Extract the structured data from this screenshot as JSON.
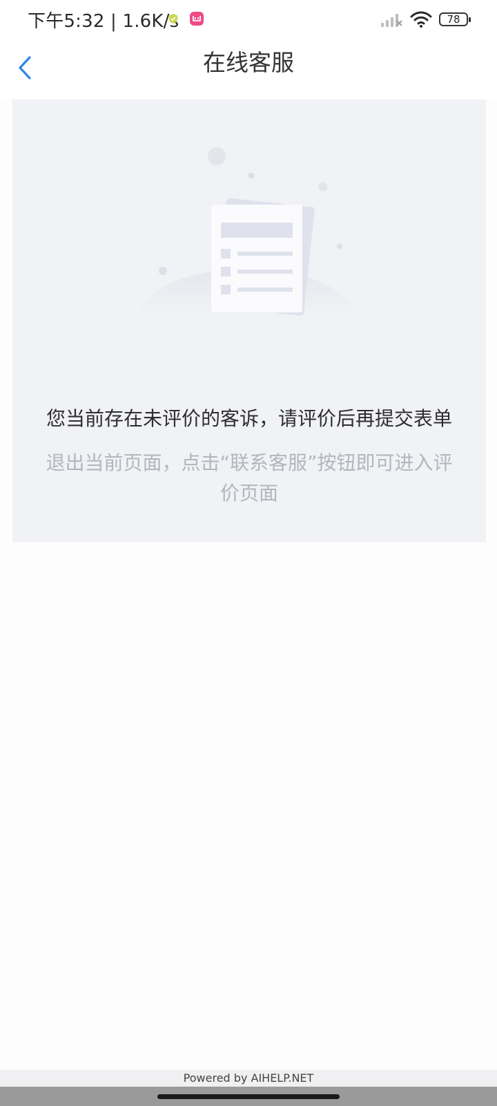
{
  "status_bar": {
    "time_text": "下午5:32 | 1.6K/s",
    "battery_level": "78",
    "icons": [
      "shield-check-icon",
      "app-notification-icon",
      "signal-icon",
      "wifi-icon",
      "battery-icon"
    ]
  },
  "nav": {
    "title": "在线客服",
    "back_icon": "chevron-left-icon"
  },
  "empty_state": {
    "illustration": "document-empty-icon",
    "message": "您当前存在未评价的客诉，请评价后再提交表单",
    "hint_line1": "退出当前页面，点击“联系客服”按钮即可进入评",
    "hint_line2": "价页面"
  },
  "footer": {
    "powered_by": "Powered by AIHELP.NET"
  },
  "colors": {
    "accent": "#2a86e8",
    "panel_bg": "#f1f2f5",
    "hint_text": "#b3b6bd",
    "main_text": "#2e2e2e"
  }
}
